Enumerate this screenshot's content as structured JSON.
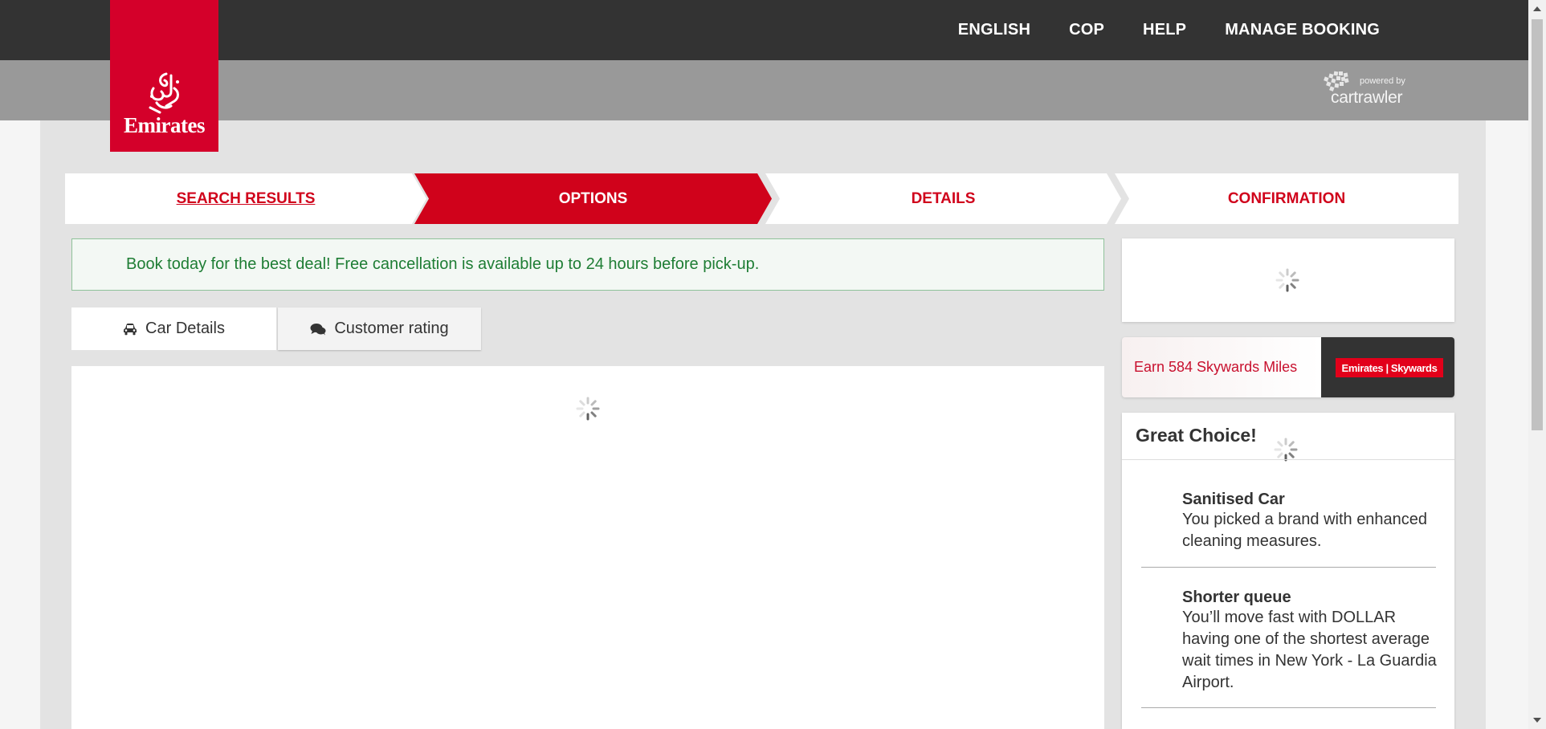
{
  "topnav": {
    "language": "ENGLISH",
    "currency": "COP",
    "help": "HELP",
    "manage_booking": "MANAGE BOOKING"
  },
  "logo": {
    "text": "Emirates",
    "color": "#d4002a"
  },
  "powered_by": {
    "label": "powered by",
    "brand": "cartrawler"
  },
  "steps": [
    {
      "label": "SEARCH RESULTS",
      "state": "link"
    },
    {
      "label": "OPTIONS",
      "state": "active"
    },
    {
      "label": "DETAILS",
      "state": "upcoming"
    },
    {
      "label": "CONFIRMATION",
      "state": "upcoming"
    }
  ],
  "banner": {
    "text": "Book today for the best deal! Free cancellation is available up to 24 hours before pick-up."
  },
  "tabs": [
    {
      "label": "Car Details",
      "icon": "car-icon"
    },
    {
      "label": "Customer rating",
      "icon": "comments-icon"
    }
  ],
  "skywards": {
    "earn_text": "Earn 584 Skywards Miles",
    "badge": "Emirates | Skywards"
  },
  "great_choice": {
    "title": "Great Choice!",
    "features": [
      {
        "title": "Sanitised Car",
        "text": "You picked a brand with enhanced cleaning measures."
      },
      {
        "title": "Shorter queue",
        "text": "You’ll move fast with DOLLAR having one of the shortest average wait times in New York - La Guardia Airport."
      }
    ]
  },
  "colors": {
    "accent": "#d0021b",
    "topbar": "#333333",
    "subbar": "#999999",
    "banner_text": "#1e7d34"
  }
}
